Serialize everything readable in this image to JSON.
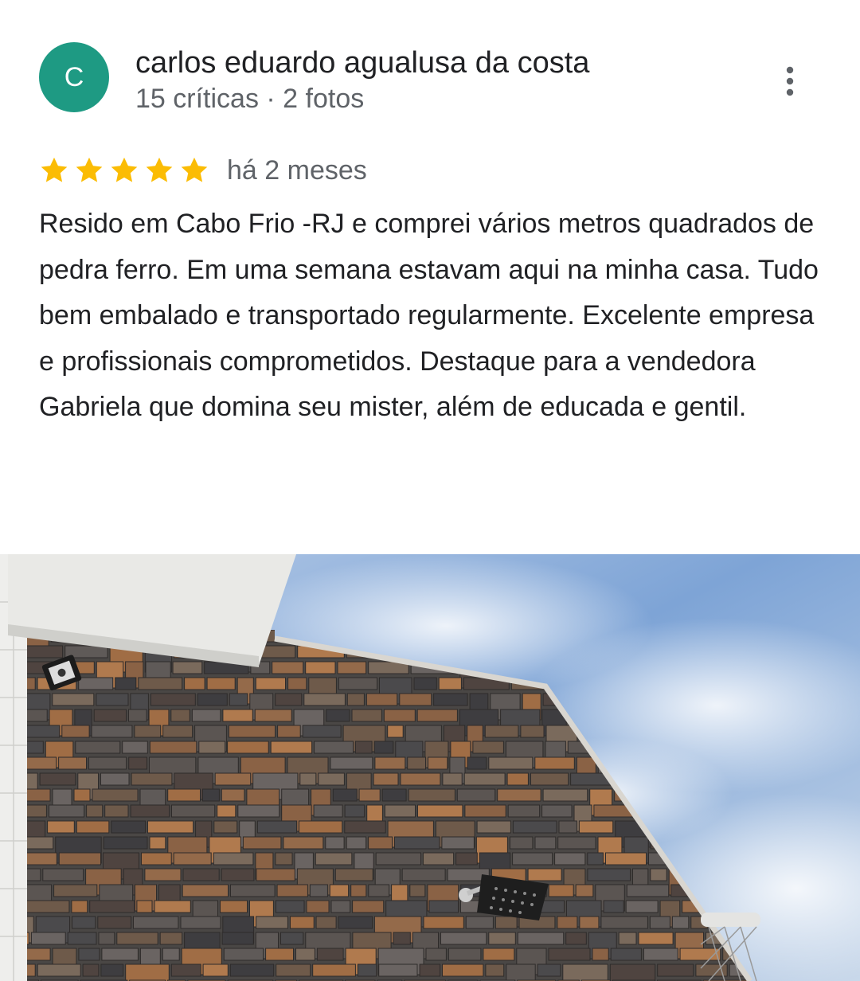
{
  "review": {
    "author": {
      "initial": "C",
      "avatar_color": "#1e9a83",
      "name": "carlos eduardo agualusa da costa",
      "meta": "15 críticas · 2 fotos"
    },
    "menu_icon": "more-vert-icon",
    "rating": {
      "stars": 5,
      "max": 5,
      "star_color": "#fbbc04",
      "time": "há 2 meses"
    },
    "text": "Resido em Cabo Frio -RJ e comprei vários metros quadrados de pedra ferro. Em uma semana estavam aqui na minha casa. Tudo bem embalado e transportado regularmente. Excelente empresa e profissionais comprometidos. Destaque para a vendedora Gabriela que domina seu mister, além de educada e gentil.",
    "photo": {
      "subject": "stone-wall-photo"
    }
  }
}
